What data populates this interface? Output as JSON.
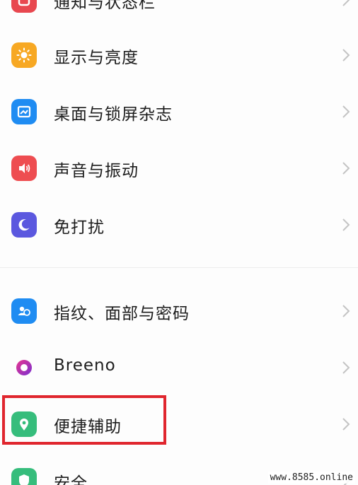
{
  "settings": {
    "items": [
      {
        "label": "通知与状态栏",
        "icon": "notification-icon",
        "color": "#e8474f"
      },
      {
        "label": "显示与亮度",
        "icon": "sun-icon",
        "color": "#f7a823"
      },
      {
        "label": "桌面与锁屏杂志",
        "icon": "wallpaper-icon",
        "color": "#1f8cf2"
      },
      {
        "label": "声音与振动",
        "icon": "speaker-icon",
        "color": "#ee4d51"
      },
      {
        "label": "免打扰",
        "icon": "moon-icon",
        "color": "#5b58df"
      },
      {
        "label": "指纹、面部与密码",
        "icon": "biometric-icon",
        "color": "#1f8cf2"
      },
      {
        "label": "Breeno",
        "icon": "breeno-icon",
        "color": "#c0279e"
      },
      {
        "label": "便捷辅助",
        "icon": "assist-icon",
        "color": "#36bd7c"
      },
      {
        "label": "安全",
        "icon": "security-icon",
        "color": "#36bd7c"
      }
    ]
  },
  "watermark": "www.8585.online"
}
